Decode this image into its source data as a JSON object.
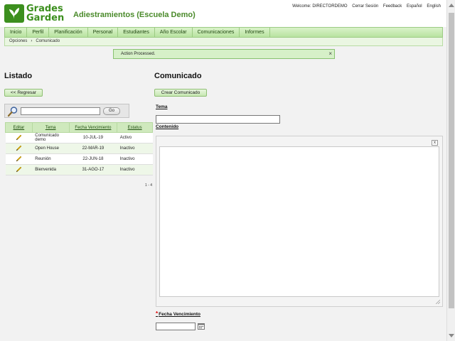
{
  "header": {
    "logo_line1": "Grades",
    "logo_line2": "Garden",
    "app_title": "Adiestramientos (Escuela Demo)",
    "welcome": "Welcome: DIRECTORDEMO",
    "links": [
      "Cerrar Sesión",
      "Feedback",
      "Español",
      "English"
    ]
  },
  "nav": [
    "Inicio",
    "Perfil",
    "Planificación",
    "Personal",
    "Estudiantes",
    "Año Escolar",
    "Comunicaciones",
    "Informes"
  ],
  "breadcrumb": [
    "Opciones",
    "Comunicado"
  ],
  "alert": {
    "text": "Action Processed.",
    "close": "×"
  },
  "left": {
    "title": "Listado",
    "back_label": "<< Regresar",
    "search": {
      "value": "",
      "go_label": "Go"
    },
    "table": {
      "columns": [
        "Editar",
        "Tema",
        "Fecha Vencimiento",
        "Estatus"
      ],
      "rows": [
        {
          "tema": "Comunicado demo",
          "fecha": "10-JUL-19",
          "estatus": "Activo"
        },
        {
          "tema": "Open House",
          "fecha": "22-MAR-19",
          "estatus": "Inactivo"
        },
        {
          "tema": "Reunión",
          "fecha": "22-JUN-18",
          "estatus": "Inactivo"
        },
        {
          "tema": "Bienvenida",
          "fecha": "31-AGO-17",
          "estatus": "Inactivo"
        }
      ]
    },
    "pager": "1 - 4"
  },
  "right": {
    "title": "Comunicado",
    "create_label": "Crear Comunicado",
    "tema_label": "Tema",
    "tema_value": "",
    "contenido_label": "Contenido",
    "editor_close": "x",
    "required_mark": "*",
    "fecha_label": "Fecha Vencimiento",
    "fecha_value": ""
  },
  "colors": {
    "brand_green": "#3c8f1e",
    "nav_bg": "#c7e8b3",
    "alert_bg": "#d6f0c8"
  }
}
